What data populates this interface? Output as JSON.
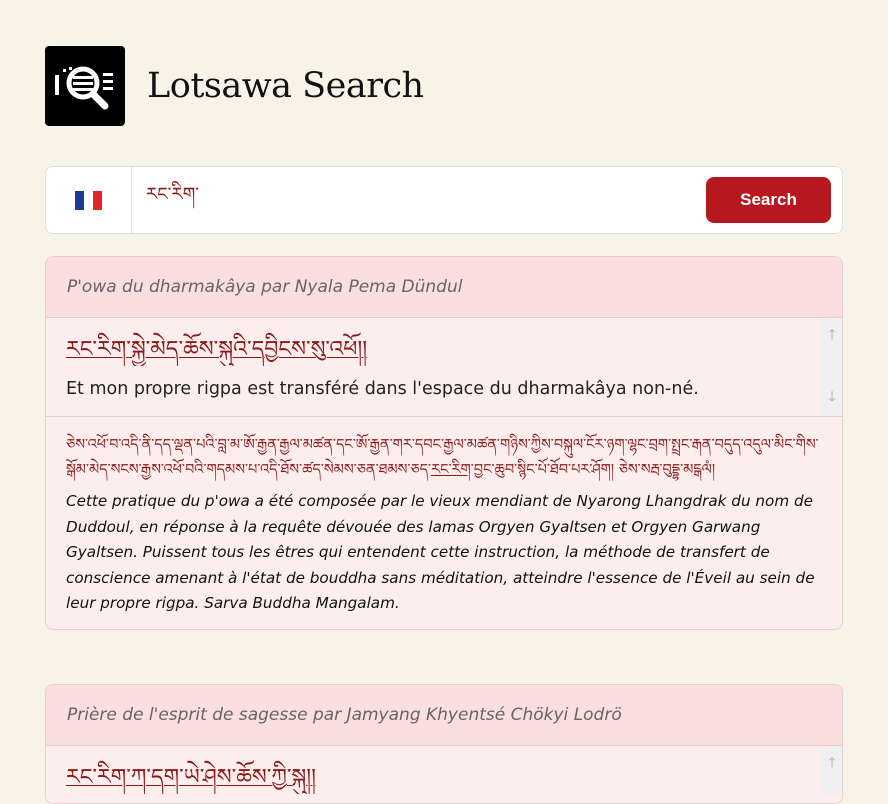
{
  "app": {
    "title": "Lotsawa Search"
  },
  "search": {
    "language": "French",
    "query": "རང་རིག་",
    "button_label": "Search"
  },
  "results": [
    {
      "title": "P'owa du dharmakâya par Nyala Pema Dündul",
      "tibetan_line": "རང་རིག་སྐྱེ་མེད་ཆོས་སྐུའི་དབྱིངས་སུ་འཕོ།།",
      "french_line": "Et mon propre rigpa est transféré dans l'espace du dharmakâya non-né.",
      "tibetan_colophon_before": "ཅེས་འཕོ་བ་འདི་ནི་དད་ལྡན་པའི་བླ་མ་ཨོ་རྒྱན་རྒྱལ་མཚན་དང་ཨོ་རྒྱན་གར་དབང་རྒྱལ་མཚན་གཉིས་ཀྱིས་བསྐུལ་ངོར་ཉག་ལྷང་བྲག་སྤྲང་རྒན་བདུད་འདུལ་མིང་གིས་སྒོམ་མེད་སངས་རྒྱས་འཕོ་བའི་གདམས་པ་འདི་ཐོས་ཚད་སེམས་ཅན་ཐམས་ཅད་",
      "tibetan_colophon_mark": "རང་རིག",
      "tibetan_colophon_after": "་བྱང་ཆུབ་སྙིང་པོ་ཐོབ་པར་ཤོག། ཅེས་སརྦ་བུདྡྷ་མངྒལཾ།",
      "french_colophon": "Cette pratique du p'owa a été composée par le vieux mendiant de Nyarong Lhangdrak du nom de Duddoul, en réponse à la requête dévouée des lamas Orgyen Gyaltsen et Orgyen Garwang Gyaltsen. Puissent tous les êtres qui entendent cette instruction, la méthode de transfert de conscience amenant à l'état de bouddha sans méditation, atteindre l'essence de l'Éveil au sein de leur propre rigpa. Sarva Buddha Mangalam."
    },
    {
      "title": "Prière de l'esprit de sagesse par Jamyang Khyentsé Chökyi Lodrö",
      "tibetan_line": "རང་རིག་ཀ་དག་ཡེ་ཤེས་ཆོས་ཀྱི་སྐུ།།"
    }
  ],
  "colors": {
    "accent": "#b5191f",
    "tibetan_text": "#8a1a1a",
    "card_header": "#fbdede",
    "card_body": "#fdeeee",
    "page_bg": "#f7f3e6"
  },
  "icons": {
    "logo": "magnifier-document-icon",
    "scroll_up": "arrow-up-icon",
    "scroll_down": "arrow-down-icon",
    "flag": "french-flag-icon"
  }
}
